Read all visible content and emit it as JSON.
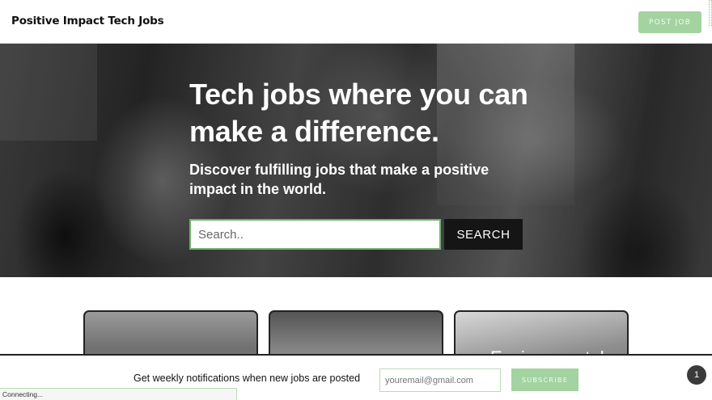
{
  "header": {
    "brand": "Positive Impact Tech Jobs",
    "post_job_label": "POST JOB"
  },
  "hero": {
    "title": "Tech jobs where you can make a difference.",
    "subtitle": "Discover fulfilling jobs that make a positive impact in the world.",
    "search_placeholder": "Search..",
    "search_button_label": "SEARCH"
  },
  "cards": [
    {
      "title": ""
    },
    {
      "title": ""
    },
    {
      "title": "Environmental"
    }
  ],
  "newsletter": {
    "text": "Get weekly notifications when new jobs are posted",
    "email_placeholder": "youremail@gmail.com",
    "subscribe_label": "SUBSCRIBE"
  },
  "notification_badge": "1",
  "status_text": "Connecting...",
  "colors": {
    "accent_green": "#a3d3a0",
    "search_border": "#6fb36c",
    "dark": "#151515"
  }
}
